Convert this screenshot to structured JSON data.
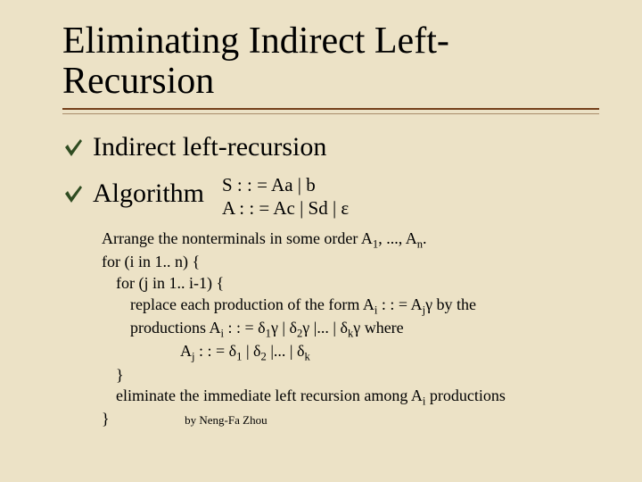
{
  "title_line1": "Eliminating Indirect Left-",
  "title_line2": "Recursion",
  "bullet1": "Indirect left-recursion",
  "bullet2": "Algorithm",
  "grammar": {
    "line1": "S : : = Aa | b",
    "line2": "A : : = Ac | Sd | ε"
  },
  "algo": {
    "l1_a": "Arrange the nonterminals in some order A",
    "l1_b": ", ..., A",
    "l1_c": ".",
    "l2": "for (i in 1.. n) {",
    "l3": "for (j in 1.. i-1) {",
    "l4_a": "replace each production of the form A",
    "l4_b": " : : = A",
    "l4_c": "γ  by the",
    "l5_a": "productions A",
    "l5_b": " : : = δ",
    "l5_c": "γ | δ",
    "l5_d": "γ |... | δ",
    "l5_e": "γ where",
    "l6_a": "A",
    "l6_b": " : : = δ",
    "l6_c": " | δ",
    "l6_d": " |... | δ",
    "l7": "}",
    "l8_a": "eliminate the immediate left recursion among A",
    "l8_b": " productions",
    "l9": "}"
  },
  "sub": {
    "one": "1",
    "two": "2",
    "n": "n",
    "i": "i",
    "j": "j",
    "k": "k"
  },
  "byline": "by Neng-Fa Zhou"
}
